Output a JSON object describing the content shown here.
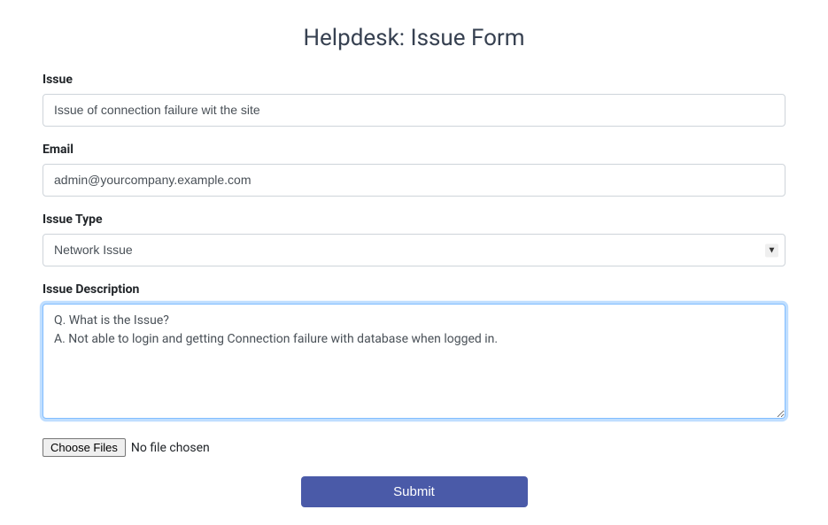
{
  "page": {
    "title": "Helpdesk: Issue Form"
  },
  "form": {
    "issue": {
      "label": "Issue",
      "value": "Issue of connection failure wit the site"
    },
    "email": {
      "label": "Email",
      "value": "admin@yourcompany.example.com"
    },
    "issueType": {
      "label": "Issue Type",
      "selected": "Network Issue"
    },
    "description": {
      "label": "Issue Description",
      "value": "Q. What is the Issue?\nA. Not able to login and getting Connection failure with database when logged in."
    },
    "file": {
      "buttonLabel": "Choose Files",
      "status": "No file chosen"
    },
    "submit": {
      "label": "Submit"
    }
  }
}
